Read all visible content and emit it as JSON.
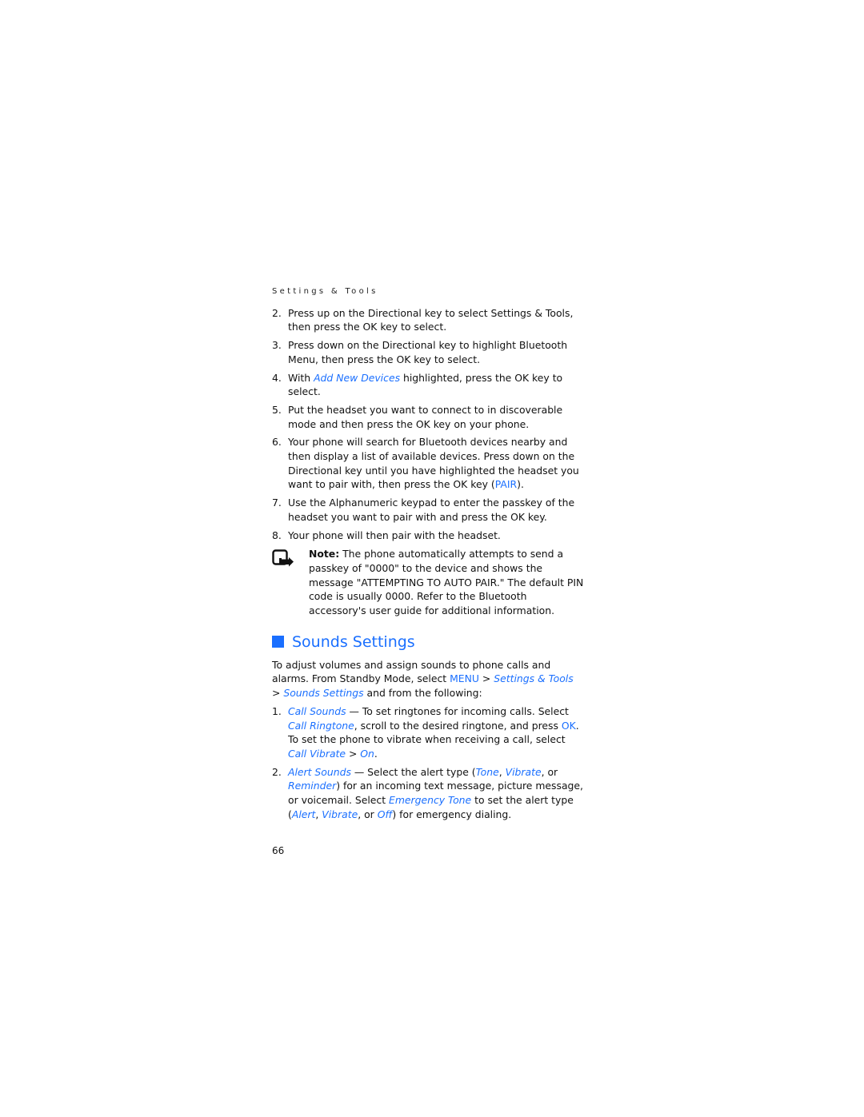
{
  "running_head": "Settings & Tools",
  "steps_a": [
    {
      "num": "2.",
      "text": "Press up on the Directional key to select Settings & Tools, then press the OK key to select."
    },
    {
      "num": "3.",
      "text": "Press down on the Directional key to highlight Bluetooth Menu, then press the OK key to select."
    },
    {
      "num": "4.",
      "pre": "With ",
      "link": "Add New Devices",
      "post": " highlighted, press the OK key to select."
    },
    {
      "num": "5.",
      "text": "Put the headset you want to connect to in discoverable mode and then press the OK key on your phone."
    },
    {
      "num": "6.",
      "pre": "Your phone will search for Bluetooth devices nearby and then display a list of available devices. Press down on the Directional key until you have highlighted the headset you want to pair with, then press the OK key (",
      "key": "PAIR",
      "post": ")."
    },
    {
      "num": "7.",
      "text": "Use the Alphanumeric keypad to enter the passkey of the headset you want to pair with and press the OK key."
    },
    {
      "num": "8.",
      "text": "Your phone will then pair with the headset."
    }
  ],
  "note": {
    "icon": "note-icon",
    "label": "Note:",
    "text": " The phone automatically attempts to send a passkey of \"0000\" to the device and shows the message \"ATTEMPTING TO AUTO PAIR.\" The default PIN code is usually 0000. Refer to the Bluetooth accessory's user guide for additional information."
  },
  "section": {
    "title": "Sounds Settings",
    "intro_1": "To adjust volumes and assign sounds to phone calls and alarms. From Standby Mode, select ",
    "menu": "MENU",
    "sep1": " > ",
    "path1": "Settings & Tools",
    "sep2": " > ",
    "path2": "Sounds Settings",
    "intro_2": " and from the following:",
    "items": [
      {
        "num": "1.",
        "name": "Call Sounds",
        "t1": " — To set ringtones for incoming calls. Select ",
        "l1": "Call Ringtone",
        "t2": ", scroll to the desired ringtone, and press ",
        "k1": "OK",
        "t3": ". To set the phone to vibrate when receiving a call, select ",
        "l2": "Call Vibrate",
        "t4": " > ",
        "l3": "On",
        "t5": "."
      },
      {
        "num": "2.",
        "name": "Alert Sounds",
        "t1": " — Select the alert type (",
        "l1": "Tone",
        "t2": ", ",
        "l2": "Vibrate",
        "t3": ", or ",
        "l3": "Reminder",
        "t4": ") for an incoming text message, picture message, or voicemail. Select ",
        "l4": "Emergency Tone",
        "t5": " to set the alert type (",
        "l5": "Alert",
        "t6": ", ",
        "l6": "Vibrate",
        "t7": ", or ",
        "l7": "Off",
        "t8": ") for emergency dialing."
      }
    ]
  },
  "page_number": "66",
  "colors": {
    "accent": "#1a6fff",
    "text": "#111111"
  }
}
